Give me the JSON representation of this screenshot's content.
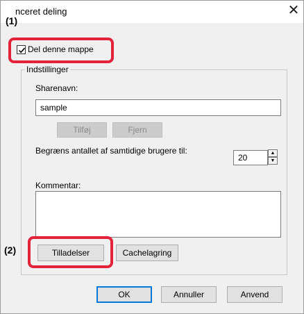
{
  "window": {
    "title_visible": "nceret deling",
    "close_glyph": "✕"
  },
  "markers": {
    "one": "(1)",
    "two": "(2)"
  },
  "share": {
    "checkbox_label": "Del denne mappe",
    "checked": true
  },
  "settings": {
    "group_label": "Indstillinger",
    "share_name_label": "Sharenavn:",
    "share_name_value": "sample",
    "add_button": "Tilføj",
    "remove_button": "Fjern",
    "limit_label": "Begræns antallet af samtidige brugere til:",
    "limit_value": "20",
    "comment_label": "Kommentar:",
    "comment_value": ""
  },
  "actions": {
    "permissions": "Tilladelser",
    "caching": "Cachelagring"
  },
  "footer": {
    "ok": "OK",
    "cancel": "Annuller",
    "apply": "Anvend"
  },
  "colors": {
    "highlight": "#e3233a",
    "accent": "#0078d7"
  }
}
